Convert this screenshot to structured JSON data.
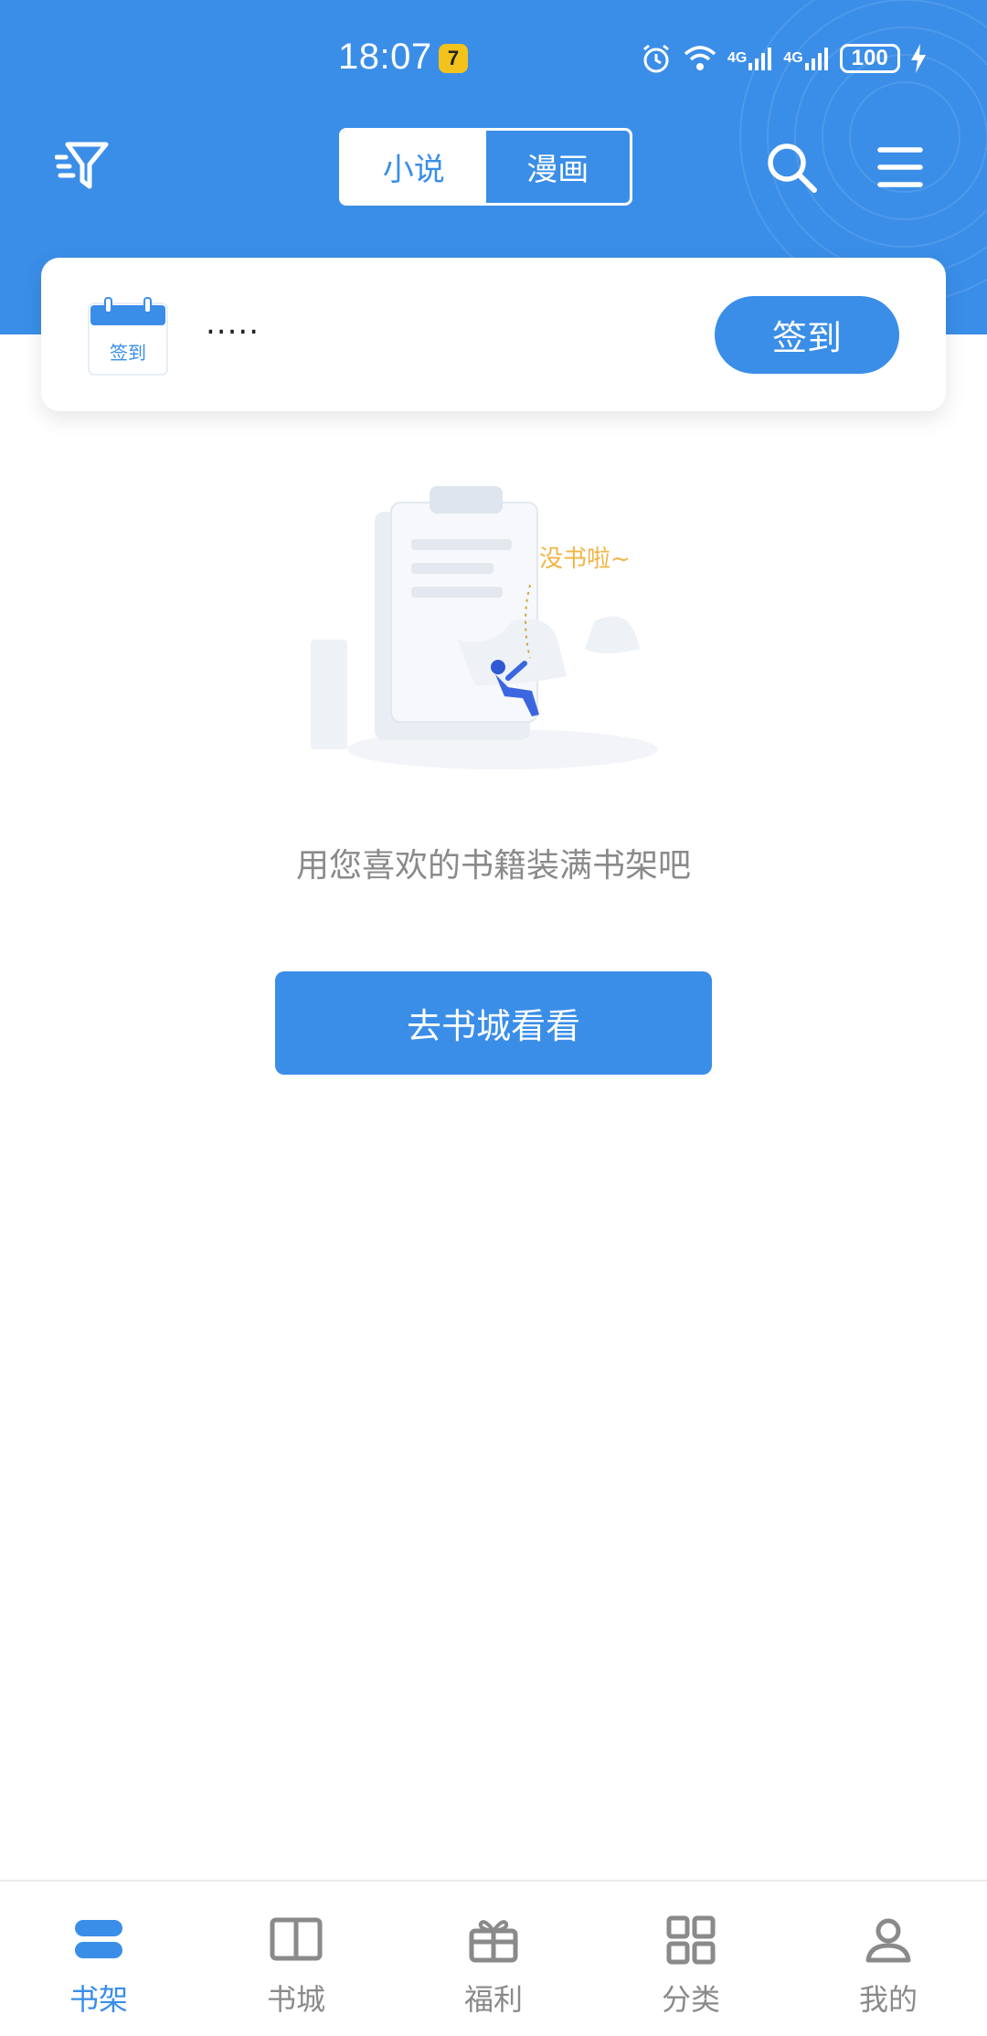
{
  "status_bar": {
    "time": "18:07",
    "notification_badge": "7",
    "net1": "4G",
    "net2": "4G",
    "battery": "100"
  },
  "header": {
    "tabs": [
      {
        "label": "小说",
        "active": true
      },
      {
        "label": "漫画",
        "active": false
      }
    ],
    "icons": [
      "filter-icon",
      "search-icon",
      "menu-icon"
    ]
  },
  "sign_card": {
    "calendar_label": "签到",
    "text": ".....",
    "button_label": "签到"
  },
  "empty_state": {
    "illustration_text": "没书啦~",
    "message": "用您喜欢的书籍装满书架吧",
    "button_label": "去书城看看"
  },
  "tab_bar": {
    "items": [
      {
        "label": "书架",
        "icon": "bookshelf-icon",
        "active": true
      },
      {
        "label": "书城",
        "icon": "book-icon",
        "active": false
      },
      {
        "label": "福利",
        "icon": "gift-icon",
        "active": false
      },
      {
        "label": "分类",
        "icon": "grid-icon",
        "active": false
      },
      {
        "label": "我的",
        "icon": "user-icon",
        "active": false
      }
    ]
  },
  "colors": {
    "primary": "#3a8ee8",
    "text_gray": "#8a8a8a",
    "white": "#ffffff"
  }
}
